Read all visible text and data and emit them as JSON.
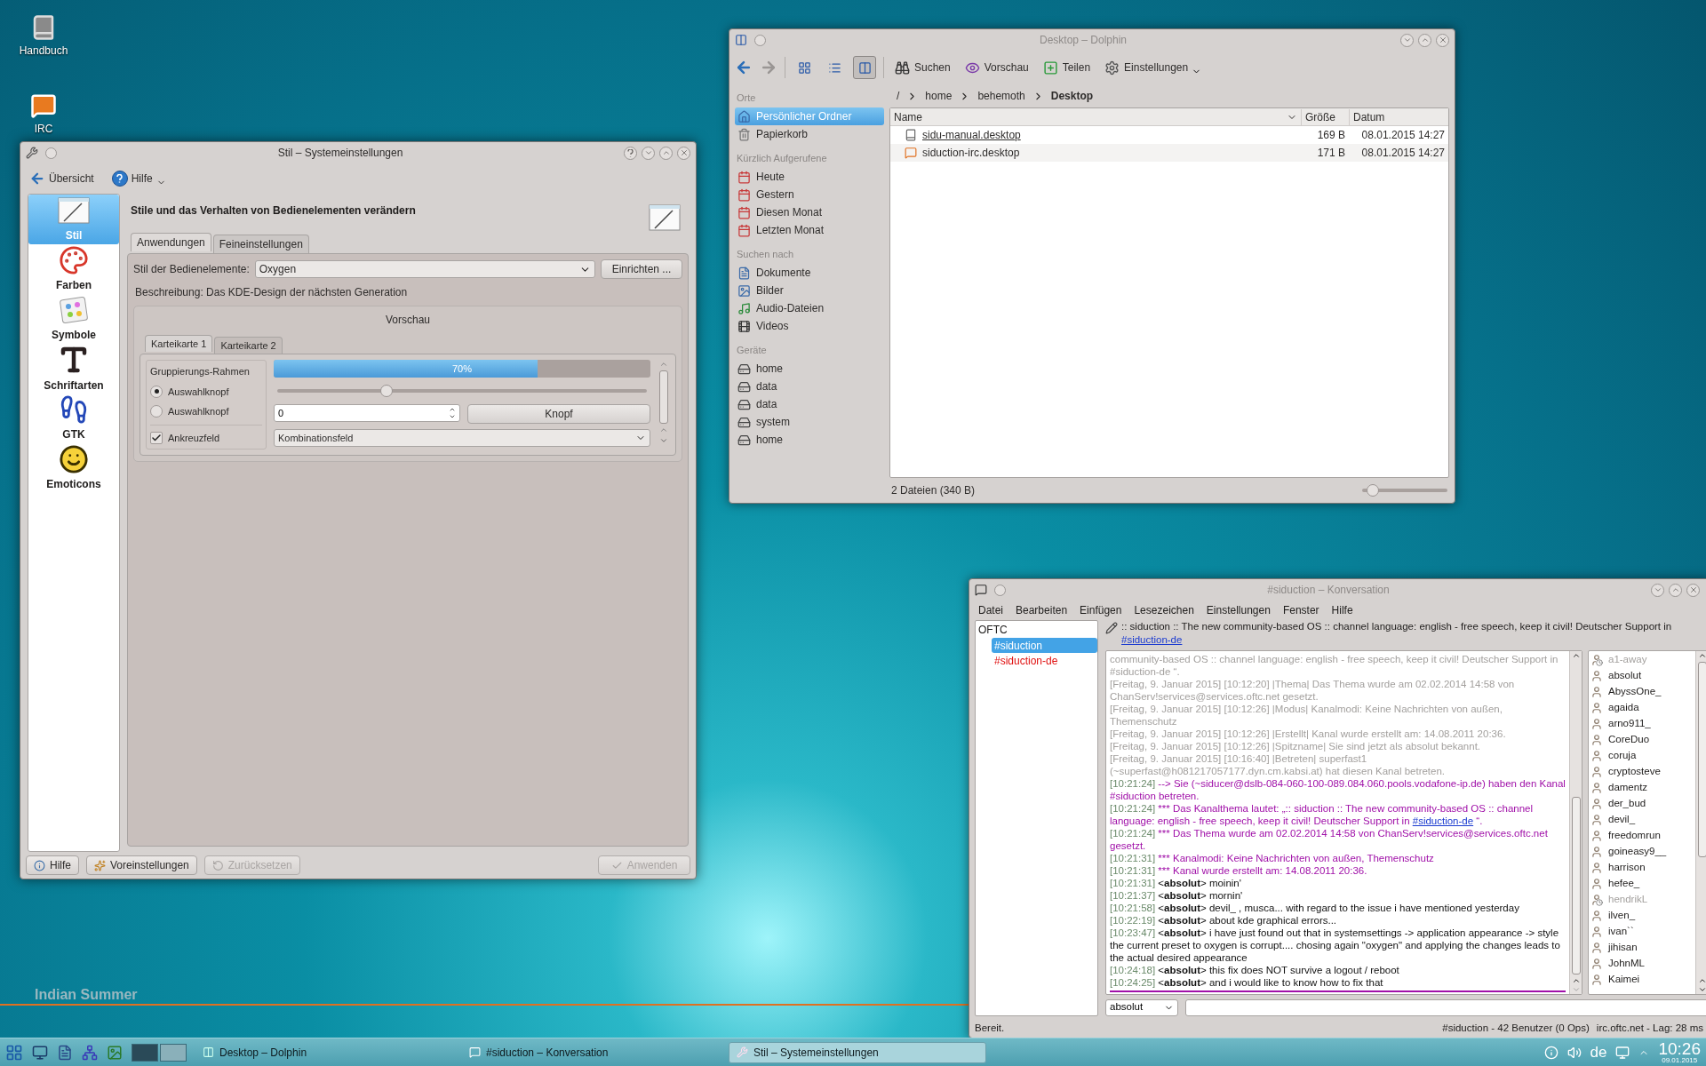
{
  "desktop": {
    "icons": [
      {
        "label": "Handbuch",
        "kind": "book"
      },
      {
        "label": "IRC",
        "kind": "chat"
      }
    ],
    "caption": "Indian Summer"
  },
  "settings_window": {
    "title": "Stil – Systemeinstellungen",
    "active": true,
    "toolbar": [
      {
        "label": "Übersicht",
        "kind": "back"
      },
      {
        "label": "Hilfe",
        "kind": "help"
      }
    ],
    "categories": [
      {
        "label": "Stil",
        "selected": true,
        "kind": "style"
      },
      {
        "label": "Farben",
        "selected": false,
        "kind": "colors"
      },
      {
        "label": "Symbole",
        "selected": false,
        "kind": "icons"
      },
      {
        "label": "Schriftarten",
        "selected": false,
        "kind": "fonts"
      },
      {
        "label": "GTK",
        "selected": false,
        "kind": "gtk"
      },
      {
        "label": "Emoticons",
        "selected": false,
        "kind": "emoticons"
      }
    ],
    "heading": "Stile und das Verhalten von Bedienelementen verändern",
    "tabs": [
      {
        "label": "Anwendungen",
        "selected": true
      },
      {
        "label": "Feineinstellungen",
        "selected": false
      }
    ],
    "style_label": "Stil der Bedienelemente:",
    "style_value": "Oxygen",
    "configure_button": "Einrichten ...",
    "description": "Beschreibung: Das KDE-Design der nächsten Generation",
    "preview": {
      "title": "Vorschau",
      "tabs": [
        {
          "label": "Karteikarte 1",
          "selected": true
        },
        {
          "label": "Karteikarte 2",
          "selected": false
        }
      ],
      "group_title": "Gruppierungs-Rahmen",
      "radios": [
        {
          "label": "Auswahlknopf",
          "selected": true
        },
        {
          "label": "Auswahlknopf",
          "selected": false
        }
      ],
      "checkbox": {
        "label": "Ankreuzfeld",
        "checked": true
      },
      "progress": {
        "level": 0.7,
        "reading": "70%"
      },
      "slider": {
        "level": 0.3
      },
      "spinbox": "0",
      "button": "Knopf",
      "combobox": "Kombinationsfeld"
    },
    "buttons": [
      {
        "label": "Hilfe",
        "kind": "help",
        "disabled": false
      },
      {
        "label": "Voreinstellungen",
        "kind": "defaults",
        "disabled": false
      },
      {
        "label": "Zurücksetzen",
        "kind": "reset",
        "disabled": true
      },
      {
        "label": "Anwenden",
        "kind": "apply",
        "disabled": true
      }
    ]
  },
  "dolphin": {
    "title": "Desktop – Dolphin",
    "active": false,
    "view_modes": [
      {
        "kind": "icons",
        "selected": false
      },
      {
        "kind": "compact",
        "selected": false
      },
      {
        "kind": "details",
        "selected": true
      }
    ],
    "actions": [
      {
        "label": "Suchen",
        "kind": "search"
      },
      {
        "label": "Vorschau",
        "kind": "preview"
      },
      {
        "label": "Teilen",
        "kind": "share"
      },
      {
        "label": "Einstellungen",
        "kind": "settings"
      }
    ],
    "places": [
      {
        "heading": "Orte",
        "items": [
          {
            "label": "Persönlicher Ordner",
            "kind": "home",
            "selected": true
          },
          {
            "label": "Papierkorb",
            "kind": "trash",
            "selected": false
          }
        ]
      },
      {
        "heading": "Kürzlich Aufgerufene",
        "items": [
          {
            "label": "Heute",
            "kind": "calendar",
            "selected": false
          },
          {
            "label": "Gestern",
            "kind": "calendar",
            "selected": false
          },
          {
            "label": "Diesen Monat",
            "kind": "calendar",
            "selected": false
          },
          {
            "label": "Letzten Monat",
            "kind": "calendar",
            "selected": false
          }
        ]
      },
      {
        "heading": "Suchen nach",
        "items": [
          {
            "label": "Dokumente",
            "kind": "documents",
            "selected": false
          },
          {
            "label": "Bilder",
            "kind": "images",
            "selected": false
          },
          {
            "label": "Audio-Dateien",
            "kind": "audio",
            "selected": false
          },
          {
            "label": "Videos",
            "kind": "videos",
            "selected": false
          }
        ]
      },
      {
        "heading": "Geräte",
        "items": [
          {
            "label": "home",
            "kind": "drive",
            "selected": false
          },
          {
            "label": "data",
            "kind": "drive",
            "selected": false
          },
          {
            "label": "data",
            "kind": "drive",
            "selected": false
          },
          {
            "label": "system",
            "kind": "drive",
            "selected": false
          },
          {
            "label": "home",
            "kind": "drive",
            "selected": false
          }
        ]
      }
    ],
    "breadcrumb": [
      "/",
      "home",
      "behemoth",
      "Desktop"
    ],
    "columns": [
      "Name",
      "Größe",
      "Datum"
    ],
    "files": [
      {
        "name": "sidu-manual.desktop",
        "size": "169 B",
        "date": "08.01.2015 14:27",
        "kind": "book",
        "hovered": true
      },
      {
        "name": "siduction-irc.desktop",
        "size": "171 B",
        "date": "08.01.2015 14:27",
        "kind": "chat",
        "hovered": false
      }
    ],
    "status": "2 Dateien (340 B)",
    "zoom": {
      "level": 0.05
    }
  },
  "konversation": {
    "title": "#siduction – Konversation",
    "active": false,
    "menu": [
      "Datei",
      "Bearbeiten",
      "Einfügen",
      "Lesezeichen",
      "Einstellungen",
      "Fenster",
      "Hilfe"
    ],
    "server": {
      "label": "OFTC",
      "children": [
        {
          "label": "#siduction",
          "selected": true,
          "unread": false
        },
        {
          "label": "#siduction-de",
          "selected": false,
          "unread": true
        }
      ]
    },
    "topic": {
      "text": ":: siduction :: The new community-based OS :: channel language: english - free speech, keep it civil! Deutscher Support in",
      "link": "#siduction-de"
    },
    "messages": [
      {
        "kind": "log",
        "text": "community-based OS :: channel language: english - free speech, keep it civil! Deutscher Support in #siduction-de “."
      },
      {
        "kind": "log",
        "text": "[Freitag, 9. Januar 2015] [10:12:20] |Thema| Das Thema wurde am 02.02.2014 14:58 von ChanServ!services@services.oftc.net gesetzt."
      },
      {
        "kind": "log",
        "text": "[Freitag, 9. Januar 2015] [10:12:26] |Modus| Kanalmodi: Keine Nachrichten von außen, Themenschutz"
      },
      {
        "kind": "log",
        "text": "[Freitag, 9. Januar 2015] [10:12:26] |Erstellt| Kanal wurde erstellt am: 14.08.2011 20:36."
      },
      {
        "kind": "log",
        "text": "[Freitag, 9. Januar 2015] [10:12:26] |Spitzname| Sie sind jetzt als absolut bekannt."
      },
      {
        "kind": "log",
        "text": "[Freitag, 9. Januar 2015] [10:16:40] |Betreten| superfast1 (~superfast@h081217057177.dyn.cm.kabsi.at) hat diesen Kanal betreten."
      },
      {
        "kind": "event",
        "time": "[10:21:24]",
        "text": "--> Sie (~siducer@dslb-084-060-100-089.084.060.pools.vodafone-ip.de) haben den Kanal #siduction betreten."
      },
      {
        "kind": "event",
        "time": "[10:21:24]",
        "text": "*** Das Kanalthema lautet: „:: siduction :: The new community-based OS :: channel language: english - free speech, keep it civil! Deutscher Support in",
        "link": "#siduction-de",
        "after": "“."
      },
      {
        "kind": "event",
        "time": "[10:21:24]",
        "text": "*** Das Thema wurde am 02.02.2014 14:58 von ChanServ!services@services.oftc.net gesetzt."
      },
      {
        "kind": "event",
        "time": "[10:21:31]",
        "text": "*** Kanalmodi: Keine Nachrichten von außen, Themenschutz"
      },
      {
        "kind": "event",
        "time": "[10:21:31]",
        "text": "*** Kanal wurde erstellt am: 14.08.2011 20:36."
      },
      {
        "kind": "message",
        "time": "[10:21:31]",
        "text": "<**absolut**> moinin'"
      },
      {
        "kind": "message",
        "time": "[10:21:37]",
        "text": "<**absolut**> mornin'"
      },
      {
        "kind": "message",
        "time": "[10:21:58]",
        "text": "<**absolut**> devil_ , musca... with regard to the issue i have mentioned yesterday"
      },
      {
        "kind": "message",
        "time": "[10:22:19]",
        "text": "<**absolut**> about kde graphical errors..."
      },
      {
        "kind": "message",
        "time": "[10:23:47]",
        "text": "<**absolut**> i have just found out that in systemsettings -> application appearance -> style the current preset to oxygen is corrupt.... chosing again \"oxygen\" and applying the changes leads to the actual desired appearance"
      },
      {
        "kind": "message",
        "time": "[10:24:18]",
        "text": "<**absolut**> this fix does NOT survive a logout / reboot"
      },
      {
        "kind": "message",
        "time": "[10:24:25]",
        "text": "<**absolut**> and i would like to know how to fix that"
      }
    ],
    "nicks": [
      {
        "name": "a1-away",
        "away": true
      },
      {
        "name": "absolut",
        "away": false
      },
      {
        "name": "AbyssOne_",
        "away": false
      },
      {
        "name": "agaida",
        "away": false
      },
      {
        "name": "arno911_",
        "away": false
      },
      {
        "name": "CoreDuo",
        "away": false
      },
      {
        "name": "coruja",
        "away": false
      },
      {
        "name": "cryptosteve",
        "away": false
      },
      {
        "name": "damentz",
        "away": false
      },
      {
        "name": "der_bud",
        "away": false
      },
      {
        "name": "devil_",
        "away": false
      },
      {
        "name": "freedomrun",
        "away": false
      },
      {
        "name": "goineasy9__",
        "away": false
      },
      {
        "name": "harrison",
        "away": false
      },
      {
        "name": "hefee_",
        "away": false
      },
      {
        "name": "hendrikL",
        "away": true
      },
      {
        "name": "ilven_",
        "away": false
      },
      {
        "name": "ivan``",
        "away": false
      },
      {
        "name": "jihisan",
        "away": false
      },
      {
        "name": "JohnML",
        "away": false
      },
      {
        "name": "Kaimei",
        "away": false
      }
    ],
    "nick_select": "absolut",
    "status": [
      "Bereit.",
      "#siduction - 42 Benutzer (0 Ops)",
      "irc.oftc.net - Lag: 28 ms"
    ]
  },
  "taskbar": {
    "pager": [
      {
        "selected": true
      },
      {
        "selected": false
      }
    ],
    "tasks": [
      {
        "label": "Desktop – Dolphin",
        "kind": "dolphin",
        "selected": false
      },
      {
        "label": "#siduction – Konversation",
        "kind": "chat",
        "selected": false
      },
      {
        "label": "Stil – Systemeinstellungen",
        "kind": "settings",
        "selected": true
      }
    ],
    "keyboard": "de",
    "time": "10:26",
    "date": "09.01.2015"
  }
}
